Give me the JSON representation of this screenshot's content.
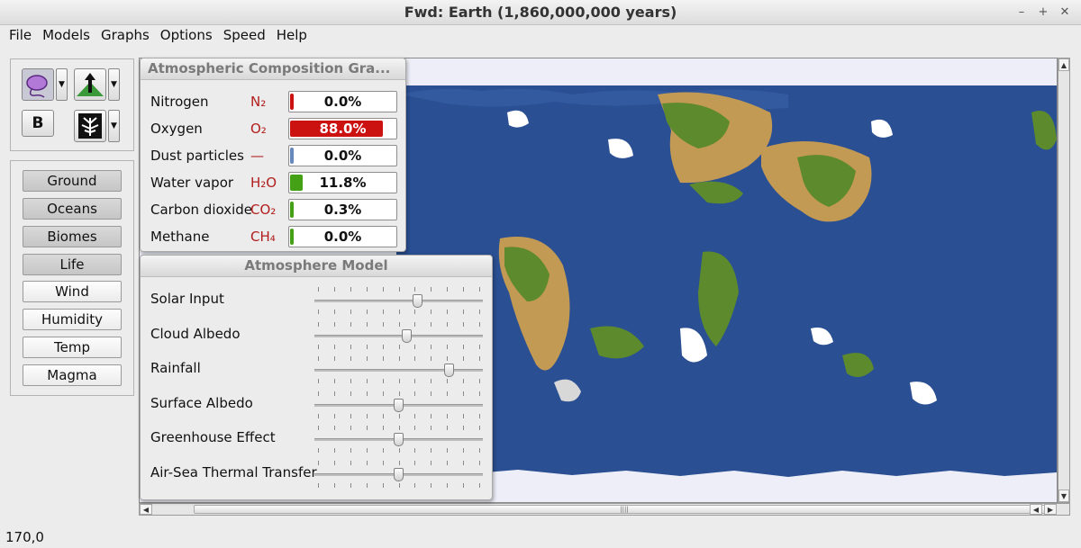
{
  "window": {
    "title": "Fwd: Earth (1,860,000,000 years)"
  },
  "menu": [
    "File",
    "Models",
    "Graphs",
    "Options",
    "Speed",
    "Help"
  ],
  "tools": {
    "bold_label": "B"
  },
  "views": [
    {
      "label": "Ground",
      "active": true
    },
    {
      "label": "Oceans",
      "active": true
    },
    {
      "label": "Biomes",
      "active": true
    },
    {
      "label": "Life",
      "active": true
    },
    {
      "label": "Wind",
      "active": false
    },
    {
      "label": "Humidity",
      "active": false
    },
    {
      "label": "Temp",
      "active": false
    },
    {
      "label": "Magma",
      "active": false
    }
  ],
  "atmo_graph": {
    "title": "Atmospheric Composition Gra...",
    "gases": [
      {
        "name": "Nitrogen",
        "formula": "N₂",
        "value": "0.0%",
        "fill": 0.0,
        "color": "#cc1111"
      },
      {
        "name": "Oxygen",
        "formula": "O₂",
        "value": "88.0%",
        "fill": 0.88,
        "color": "#cc1111"
      },
      {
        "name": "Dust particles",
        "formula": "—",
        "value": "0.0%",
        "fill": 0.0,
        "color": "#6688bb"
      },
      {
        "name": "Water vapor",
        "formula": "H₂O",
        "value": "11.8%",
        "fill": 0.118,
        "color": "#44a015"
      },
      {
        "name": "Carbon dioxide",
        "formula": "CO₂",
        "value": "0.3%",
        "fill": 0.003,
        "color": "#44a015"
      },
      {
        "name": "Methane",
        "formula": "CH₄",
        "value": "0.0%",
        "fill": 0.0,
        "color": "#44a015"
      }
    ]
  },
  "atmo_model": {
    "title": "Atmosphere Model",
    "sliders": [
      {
        "label": "Solar Input",
        "level": 0.62
      },
      {
        "label": "Cloud Albedo",
        "level": 0.55
      },
      {
        "label": "Rainfall",
        "level": 0.82
      },
      {
        "label": "Surface Albedo",
        "level": 0.5
      },
      {
        "label": "Greenhouse Effect",
        "level": 0.5
      },
      {
        "label": "Air-Sea Thermal Transfer",
        "level": 0.5
      }
    ]
  },
  "status": {
    "coords": "170,0"
  },
  "colors": {
    "ocean": "#2a4f93",
    "land_green": "#5c8a2c",
    "land_desert": "#c39a53",
    "ice": "#ffffff"
  }
}
